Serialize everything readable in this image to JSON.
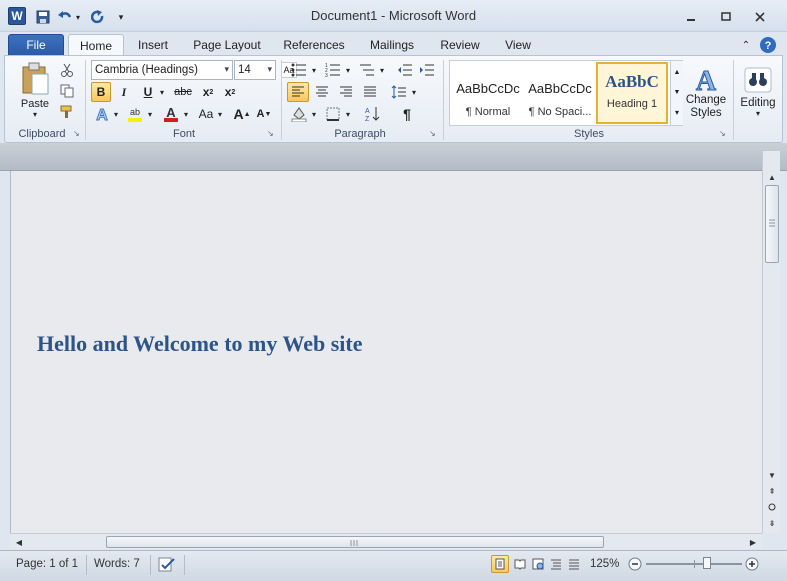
{
  "window": {
    "title": "Document1  -  Microsoft Word",
    "app_icon": "word-icon",
    "qat": [
      "save-icon",
      "undo-icon",
      "redo-icon",
      "customize-qat-icon"
    ]
  },
  "tabs": {
    "file": "File",
    "home": "Home",
    "insert": "Insert",
    "page_layout": "Page Layout",
    "references": "References",
    "mailings": "Mailings",
    "review": "Review",
    "view": "View"
  },
  "ribbon": {
    "clipboard": {
      "label": "Clipboard",
      "paste": "Paste"
    },
    "font": {
      "label": "Font",
      "font_name": "Cambria (Headings)",
      "font_size": "14",
      "bold": "B",
      "italic": "I",
      "underline": "U",
      "strike": "abc",
      "subscript": "x",
      "superscript": "x",
      "grow": "A",
      "shrink": "A",
      "change_case": "Aa"
    },
    "paragraph": {
      "label": "Paragraph",
      "pilcrow": "¶"
    },
    "styles": {
      "label": "Styles",
      "items": [
        {
          "sample": "AaBbCcDc",
          "name": "¶ Normal"
        },
        {
          "sample": "AaBbCcDc",
          "name": "¶ No Spaci..."
        },
        {
          "sample": "AaBbC",
          "name": "Heading 1"
        }
      ],
      "change_styles": "Change Styles"
    },
    "editing": {
      "label": "Editing"
    }
  },
  "document": {
    "heading": "Hello and Welcome to my Web site"
  },
  "status": {
    "page": "Page: 1 of 1",
    "words": "Words: 7",
    "zoom": "125%",
    "zoom_fraction": 0.64
  }
}
